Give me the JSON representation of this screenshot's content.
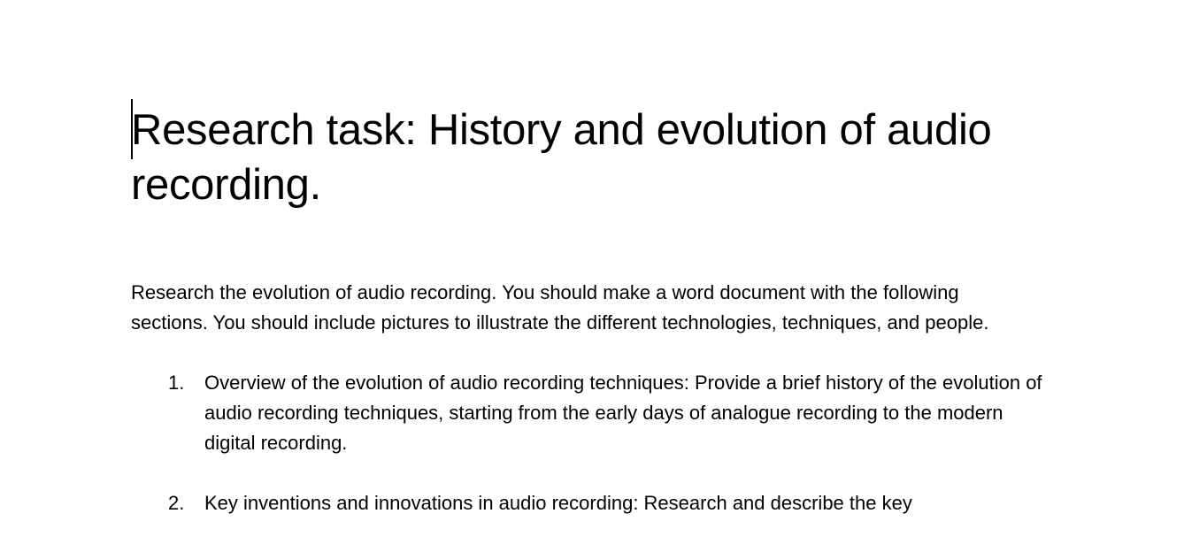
{
  "document": {
    "title": "Research task: History and evolution of audio recording.",
    "intro": "Research the evolution of audio recording. You should make a word document with the following sections. You should include pictures to illustrate the different technologies, techniques, and people.",
    "tasks": [
      {
        "number": "1.",
        "text": "Overview of the evolution of audio recording techniques: Provide a brief history of the evolution of audio recording techniques, starting from the early days of analogue recording to the modern digital recording."
      },
      {
        "number": "2.",
        "text": "Key inventions and innovations in audio recording: Research and describe the key"
      }
    ]
  }
}
